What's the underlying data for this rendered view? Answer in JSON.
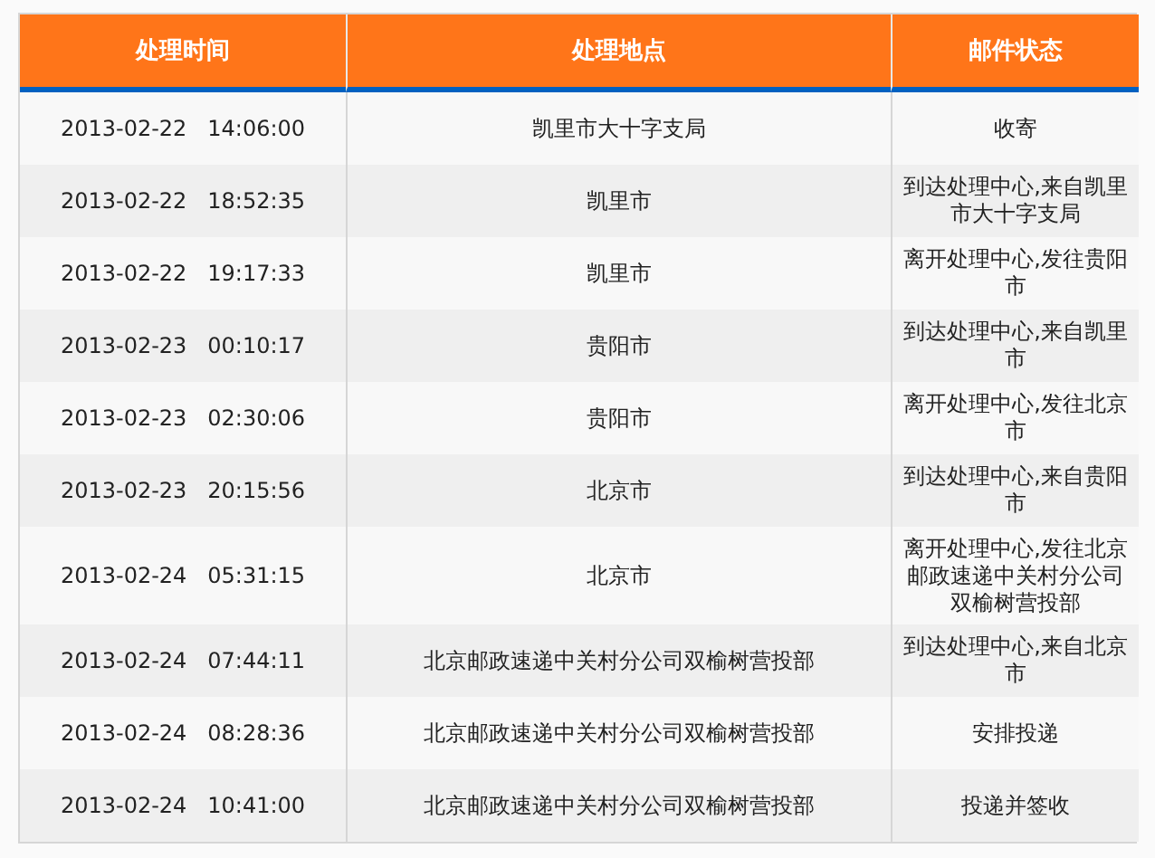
{
  "columns": [
    "处理时间",
    "处理地点",
    "邮件状态"
  ],
  "rows": [
    {
      "time": "2013-02-22   14:06:00",
      "place": "凯里市大十字支局",
      "status": "收寄"
    },
    {
      "time": "2013-02-22   18:52:35",
      "place": "凯里市",
      "status": "到达处理中心,来自凯里市大十字支局"
    },
    {
      "time": "2013-02-22   19:17:33",
      "place": "凯里市",
      "status": "离开处理中心,发往贵阳市"
    },
    {
      "time": "2013-02-23   00:10:17",
      "place": "贵阳市",
      "status": "到达处理中心,来自凯里市"
    },
    {
      "time": "2013-02-23   02:30:06",
      "place": "贵阳市",
      "status": "离开处理中心,发往北京市"
    },
    {
      "time": "2013-02-23   20:15:56",
      "place": "北京市",
      "status": "到达处理中心,来自贵阳市"
    },
    {
      "time": "2013-02-24   05:31:15",
      "place": "北京市",
      "status": "离开处理中心,发往北京邮政速递中关村分公司双榆树营投部"
    },
    {
      "time": "2013-02-24   07:44:11",
      "place": "北京邮政速递中关村分公司双榆树营投部",
      "status": "到达处理中心,来自北京市"
    },
    {
      "time": "2013-02-24   08:28:36",
      "place": "北京邮政速递中关村分公司双榆树营投部",
      "status": "安排投递"
    },
    {
      "time": "2013-02-24   10:41:00",
      "place": "北京邮政速递中关村分公司双榆树营投部",
      "status": "投递并签收"
    }
  ]
}
